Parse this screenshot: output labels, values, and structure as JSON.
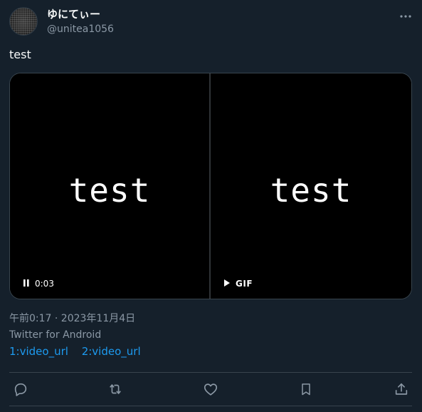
{
  "author": {
    "display_name": "ゆにてぃー",
    "handle": "@unitea1056",
    "avatar_icon": "avatar-image"
  },
  "header": {
    "more_icon": "more-icon"
  },
  "tweet": {
    "text": "test"
  },
  "media": {
    "tiles": [
      {
        "text": "test",
        "control_icon": "pause-icon",
        "control_label": "0:03"
      },
      {
        "text": "test",
        "control_icon": "play-icon",
        "control_label": "GIF"
      }
    ]
  },
  "meta": {
    "timestamp": "午前0:17 · 2023年11月4日",
    "source": "Twitter for Android",
    "links": [
      "1:video_url",
      "2:video_url"
    ]
  },
  "actions": [
    {
      "name": "reply",
      "icon": "reply-icon"
    },
    {
      "name": "retweet",
      "icon": "retweet-icon"
    },
    {
      "name": "like",
      "icon": "heart-icon"
    },
    {
      "name": "bookmark",
      "icon": "bookmark-icon"
    },
    {
      "name": "share",
      "icon": "share-icon"
    }
  ],
  "colors": {
    "background": "#15202b",
    "text_primary": "#f7f9f9",
    "text_secondary": "#8b98a5",
    "link": "#1d9bf0",
    "border": "#38444d",
    "icon": "#8b98a5"
  }
}
